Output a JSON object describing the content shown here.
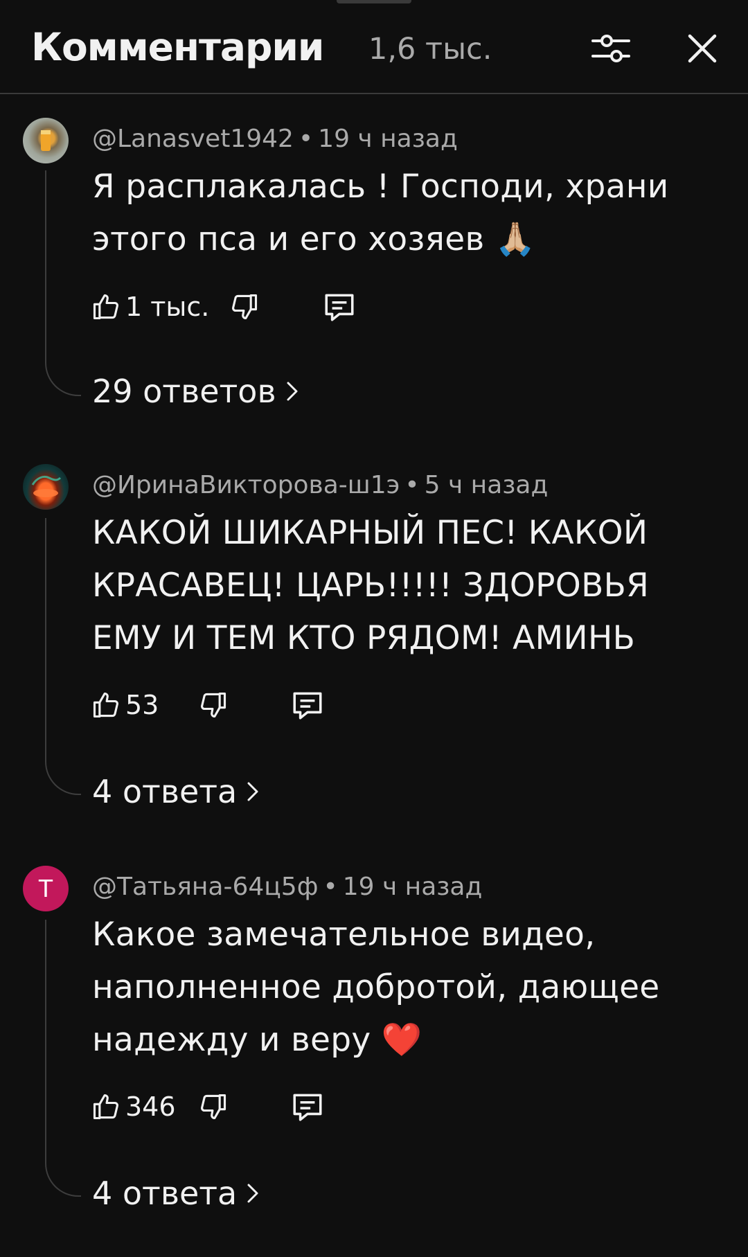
{
  "header": {
    "title": "Комментарии",
    "count": "1,6 тыс."
  },
  "icons": {
    "filter": "sliders-icon",
    "close": "close-icon",
    "like": "thumbs-up-icon",
    "dislike": "thumbs-down-icon",
    "reply": "reply-icon",
    "chevron": "chevron-right-icon"
  },
  "colors": {
    "background": "#0f0f0f",
    "text": "#f1f1f1",
    "secondary": "#aaaaaa",
    "avatar_t": "#c2185b"
  },
  "comments": [
    {
      "author": "@Lanasvet1942",
      "time": "19 ч назад",
      "text": "Я расплакалась ! Господи, храни этого пса и его хозяев 🙏🏼",
      "likes": "1 тыс.",
      "replies": "29 ответов"
    },
    {
      "author": "@ИринаВикторова-ш1э",
      "time": "5 ч назад",
      "text": "КАКОЙ ШИКАРНЫЙ ПЕС! КАКОЙ КРАСАВЕЦ! ЦАРЬ!!!!! ЗДОРОВЬЯ ЕМУ И ТЕМ КТО РЯДОМ! АМИНЬ",
      "likes": "53",
      "replies": "4 ответа"
    },
    {
      "author": "@Татьяна-64ц5ф",
      "avatar_letter": "Т",
      "time": "19 ч назад",
      "text": "Какое замечательное видео, наполненное добротой, дающее надежду и веру ❤️",
      "likes": "346",
      "replies": "4 ответа"
    }
  ]
}
